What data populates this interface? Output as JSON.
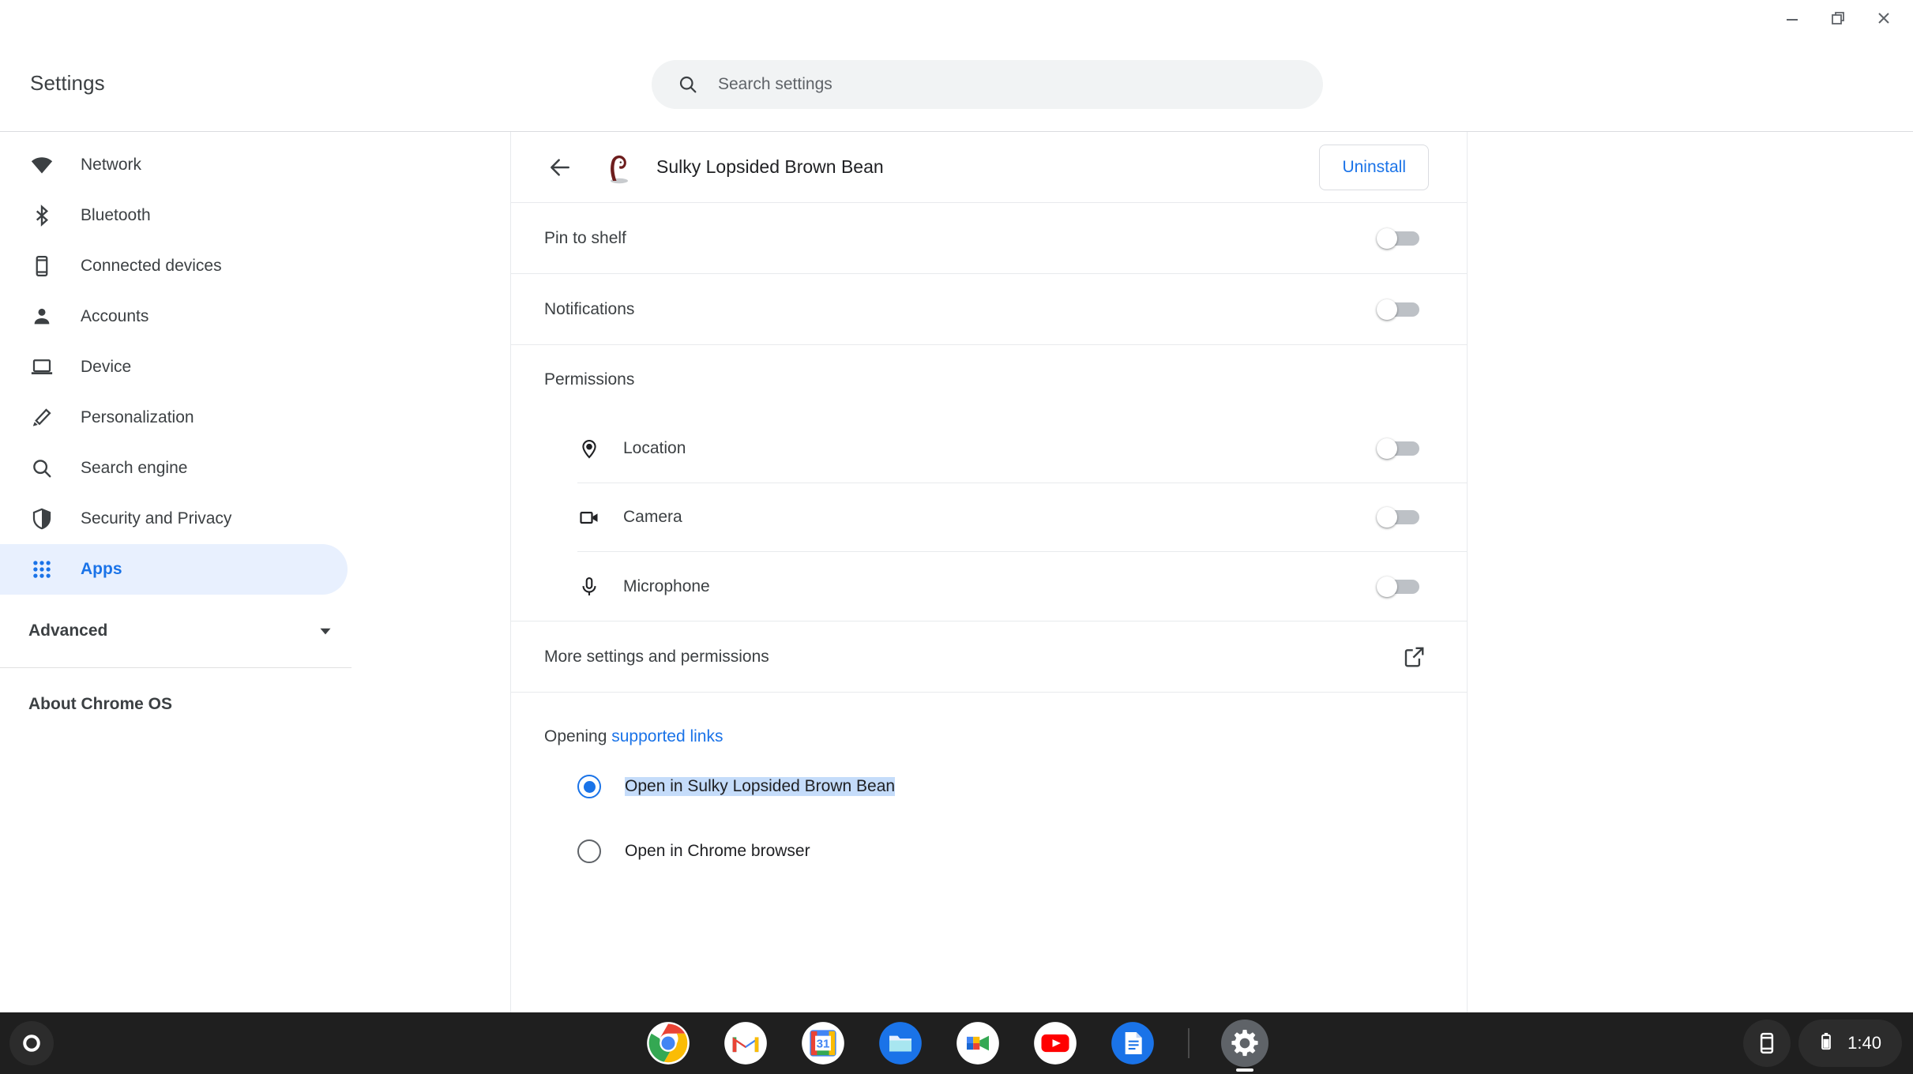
{
  "window_controls": {
    "minimize": "minimize-icon",
    "restore": "restore-icon",
    "close": "close-icon"
  },
  "header": {
    "title": "Settings"
  },
  "search": {
    "placeholder": "Search settings",
    "value": "",
    "icon": "search-icon"
  },
  "sidebar": {
    "items": [
      {
        "label": "Network",
        "icon": "wifi-icon",
        "selected": false
      },
      {
        "label": "Bluetooth",
        "icon": "bluetooth-icon",
        "selected": false
      },
      {
        "label": "Connected devices",
        "icon": "smartphone-icon",
        "selected": false
      },
      {
        "label": "Accounts",
        "icon": "person-icon",
        "selected": false
      },
      {
        "label": "Device",
        "icon": "laptop-icon",
        "selected": false
      },
      {
        "label": "Personalization",
        "icon": "pencil-icon",
        "selected": false
      },
      {
        "label": "Search engine",
        "icon": "search-icon",
        "selected": false
      },
      {
        "label": "Security and Privacy",
        "icon": "shield-icon",
        "selected": false
      },
      {
        "label": "Apps",
        "icon": "apps-grid-icon",
        "selected": true
      }
    ],
    "advanced": {
      "label": "Advanced",
      "icon": "chevron-down-icon"
    },
    "about": {
      "label": "About Chrome OS"
    }
  },
  "app_detail": {
    "back_icon": "arrow-back-icon",
    "app_icon": "app-icon",
    "app_icon_color": "#7a1f1f",
    "app_name": "Sulky Lopsided Brown Bean",
    "uninstall_label": "Uninstall",
    "rows": [
      {
        "label": "Pin to shelf",
        "toggle": "off"
      },
      {
        "label": "Notifications",
        "toggle": "off"
      }
    ],
    "permissions": {
      "title": "Permissions",
      "items": [
        {
          "label": "Location",
          "icon": "location-pin-icon",
          "toggle": "off"
        },
        {
          "label": "Camera",
          "icon": "camera-icon",
          "toggle": "off"
        },
        {
          "label": "Microphone",
          "icon": "microphone-icon",
          "toggle": "off"
        }
      ]
    },
    "more_settings": {
      "label": "More settings and permissions",
      "icon": "open-in-new-icon"
    },
    "supported_links": {
      "prefix": "Opening ",
      "link_text": "supported links",
      "options": [
        {
          "label": "Open in Sulky Lopsided Brown Bean",
          "selected": true,
          "text_highlighted": true
        },
        {
          "label": "Open in Chrome browser",
          "selected": false,
          "text_highlighted": false
        }
      ]
    }
  },
  "shelf": {
    "launcher_icon": "launcher-circle-icon",
    "apps": [
      {
        "name": "Chrome",
        "icon": "chrome-icon"
      },
      {
        "name": "Gmail",
        "icon": "gmail-icon"
      },
      {
        "name": "Google Calendar",
        "icon": "calendar-icon",
        "day": "31"
      },
      {
        "name": "Files",
        "icon": "files-icon"
      },
      {
        "name": "Google Meet",
        "icon": "meet-icon"
      },
      {
        "name": "YouTube",
        "icon": "youtube-icon"
      },
      {
        "name": "Google Docs",
        "icon": "docs-icon"
      }
    ],
    "pinned_divider": true,
    "active_app": {
      "name": "Settings",
      "icon": "gear-icon"
    },
    "status": {
      "phone_hub_icon": "phone-hub-icon",
      "battery_icon": "battery-icon",
      "time": "1:40"
    }
  },
  "colors": {
    "accent_blue": "#1a73e8",
    "selected_nav_bg": "#e8f0fe",
    "text_selection_bg": "#c5dcfa",
    "shelf_bg": "#1f1f1f",
    "toggle_off_track": "#bdc1c6"
  }
}
